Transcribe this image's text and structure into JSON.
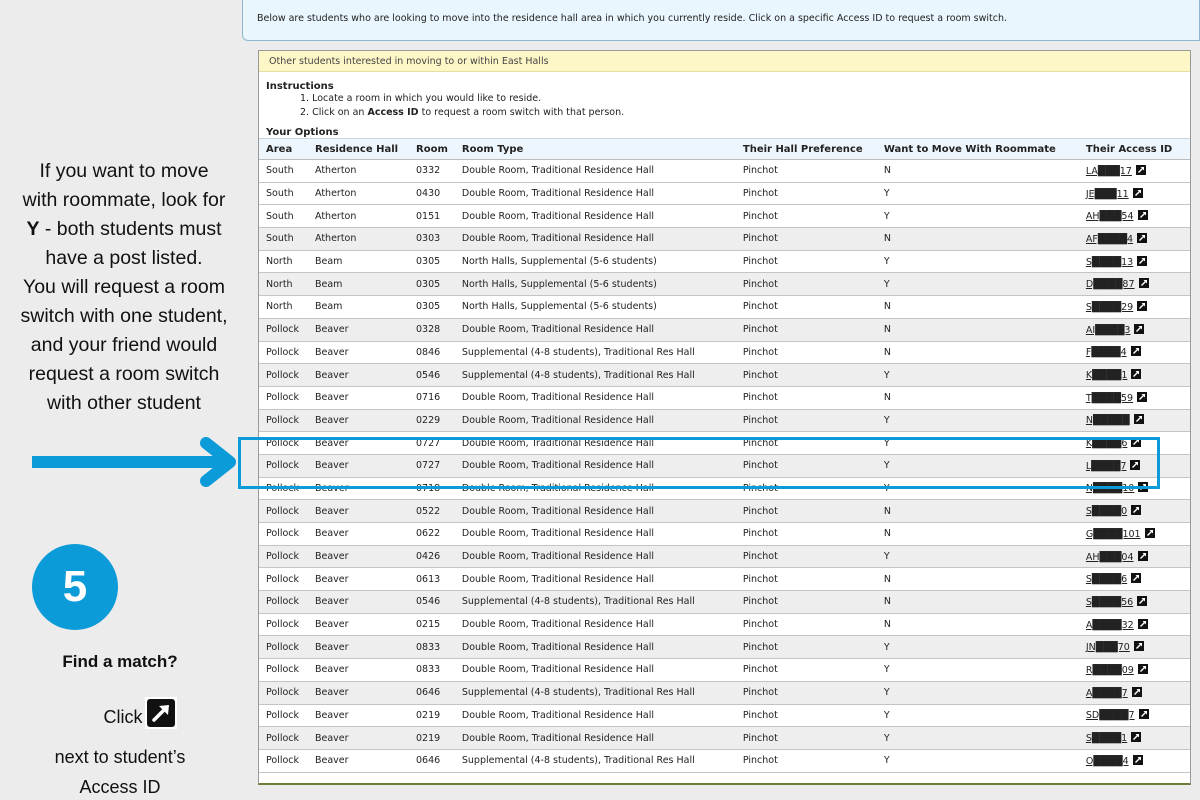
{
  "info_banner": "Below are students who are looking to move into the residence hall area in which you currently reside. Click on a specific Access ID to request a room switch.",
  "panel": {
    "header": "Other students interested in moving to or within East Halls",
    "instructions_title": "Instructions",
    "instructions": [
      {
        "prefix": "1. Locate a room in which you would like to reside.",
        "bold": "",
        "suffix": ""
      },
      {
        "prefix": "2. Click on an ",
        "bold": "Access ID",
        "suffix": " to request a room switch with that person."
      }
    ],
    "options_title": "Your Options"
  },
  "table": {
    "columns": [
      "Area",
      "Residence Hall",
      "Room",
      "Room Type",
      "Their Hall Preference",
      "Want to Move With Roommate",
      "Their Access ID"
    ],
    "rows": [
      {
        "area": "South",
        "hall": "Atherton",
        "room": "0332",
        "type": "Double Room, Traditional Residence Hall",
        "pref": "Pinchot",
        "want": "N",
        "access_id": "LA███17"
      },
      {
        "area": "South",
        "hall": "Atherton",
        "room": "0430",
        "type": "Double Room, Traditional Residence Hall",
        "pref": "Pinchot",
        "want": "Y",
        "access_id": "JE███11"
      },
      {
        "area": "South",
        "hall": "Atherton",
        "room": "0151",
        "type": "Double Room, Traditional Residence Hall",
        "pref": "Pinchot",
        "want": "Y",
        "access_id": "AH███54"
      },
      {
        "area": "South",
        "hall": "Atherton",
        "room": "0303",
        "type": "Double Room, Traditional Residence Hall",
        "pref": "Pinchot",
        "want": "N",
        "access_id": "AF████4"
      },
      {
        "area": "North",
        "hall": "Beam",
        "room": "0305",
        "type": "North Halls, Supplemental (5-6 students)",
        "pref": "Pinchot",
        "want": "Y",
        "access_id": "S████13"
      },
      {
        "area": "North",
        "hall": "Beam",
        "room": "0305",
        "type": "North Halls, Supplemental (5-6 students)",
        "pref": "Pinchot",
        "want": "Y",
        "access_id": "D████87"
      },
      {
        "area": "North",
        "hall": "Beam",
        "room": "0305",
        "type": "North Halls, Supplemental (5-6 students)",
        "pref": "Pinchot",
        "want": "N",
        "access_id": "S████29"
      },
      {
        "area": "Pollock",
        "hall": "Beaver",
        "room": "0328",
        "type": "Double Room, Traditional Residence Hall",
        "pref": "Pinchot",
        "want": "N",
        "access_id": "AI████3"
      },
      {
        "area": "Pollock",
        "hall": "Beaver",
        "room": "0846",
        "type": "Supplemental (4-8 students), Traditional Res Hall",
        "pref": "Pinchot",
        "want": "N",
        "access_id": "F████4"
      },
      {
        "area": "Pollock",
        "hall": "Beaver",
        "room": "0546",
        "type": "Supplemental (4-8 students), Traditional Res Hall",
        "pref": "Pinchot",
        "want": "Y",
        "access_id": "K████1"
      },
      {
        "area": "Pollock",
        "hall": "Beaver",
        "room": "0716",
        "type": "Double Room, Traditional Residence Hall",
        "pref": "Pinchot",
        "want": "N",
        "access_id": "T████59"
      },
      {
        "area": "Pollock",
        "hall": "Beaver",
        "room": "0229",
        "type": "Double Room, Traditional Residence Hall",
        "pref": "Pinchot",
        "want": "Y",
        "access_id": "N█████"
      },
      {
        "area": "Pollock",
        "hall": "Beaver",
        "room": "0727",
        "type": "Double Room, Traditional Residence Hall",
        "pref": "Pinchot",
        "want": "Y",
        "access_id": "K████6"
      },
      {
        "area": "Pollock",
        "hall": "Beaver",
        "room": "0727",
        "type": "Double Room, Traditional Residence Hall",
        "pref": "Pinchot",
        "want": "Y",
        "access_id": "L████7"
      },
      {
        "area": "Pollock",
        "hall": "Beaver",
        "room": "0718",
        "type": "Double Room, Traditional Residence Hall",
        "pref": "Pinchot",
        "want": "Y",
        "access_id": "N████10"
      },
      {
        "area": "Pollock",
        "hall": "Beaver",
        "room": "0522",
        "type": "Double Room, Traditional Residence Hall",
        "pref": "Pinchot",
        "want": "N",
        "access_id": "S████0"
      },
      {
        "area": "Pollock",
        "hall": "Beaver",
        "room": "0622",
        "type": "Double Room, Traditional Residence Hall",
        "pref": "Pinchot",
        "want": "N",
        "access_id": "G████101"
      },
      {
        "area": "Pollock",
        "hall": "Beaver",
        "room": "0426",
        "type": "Double Room, Traditional Residence Hall",
        "pref": "Pinchot",
        "want": "Y",
        "access_id": "AH███04"
      },
      {
        "area": "Pollock",
        "hall": "Beaver",
        "room": "0613",
        "type": "Double Room, Traditional Residence Hall",
        "pref": "Pinchot",
        "want": "N",
        "access_id": "S████6"
      },
      {
        "area": "Pollock",
        "hall": "Beaver",
        "room": "0546",
        "type": "Supplemental (4-8 students), Traditional Res Hall",
        "pref": "Pinchot",
        "want": "N",
        "access_id": "S████56"
      },
      {
        "area": "Pollock",
        "hall": "Beaver",
        "room": "0215",
        "type": "Double Room, Traditional Residence Hall",
        "pref": "Pinchot",
        "want": "N",
        "access_id": "A████32"
      },
      {
        "area": "Pollock",
        "hall": "Beaver",
        "room": "0833",
        "type": "Double Room, Traditional Residence Hall",
        "pref": "Pinchot",
        "want": "Y",
        "access_id": "JN███70"
      },
      {
        "area": "Pollock",
        "hall": "Beaver",
        "room": "0833",
        "type": "Double Room, Traditional Residence Hall",
        "pref": "Pinchot",
        "want": "Y",
        "access_id": "R████09"
      },
      {
        "area": "Pollock",
        "hall": "Beaver",
        "room": "0646",
        "type": "Supplemental (4-8 students), Traditional Res Hall",
        "pref": "Pinchot",
        "want": "Y",
        "access_id": "A████7"
      },
      {
        "area": "Pollock",
        "hall": "Beaver",
        "room": "0219",
        "type": "Double Room, Traditional Residence Hall",
        "pref": "Pinchot",
        "want": "Y",
        "access_id": "SD████7"
      },
      {
        "area": "Pollock",
        "hall": "Beaver",
        "room": "0219",
        "type": "Double Room, Traditional Residence Hall",
        "pref": "Pinchot",
        "want": "Y",
        "access_id": "S████1"
      },
      {
        "area": "Pollock",
        "hall": "Beaver",
        "room": "0646",
        "type": "Supplemental (4-8 students), Traditional Res Hall",
        "pref": "Pinchot",
        "want": "Y",
        "access_id": "O████4"
      }
    ]
  },
  "annotation": {
    "tip_lines": [
      "If you want to move",
      "with roommate, look for",
      "- both students must",
      "have a post listed.",
      "You will request a room",
      "switch with one student,",
      "and your friend would",
      "request a room switch",
      "with other student"
    ],
    "tip_bold_letter": "Y",
    "step_number": "5",
    "find_match": "Find a match?",
    "click_label": "Click",
    "next_to_line1": "next to student’s",
    "next_to_line2": "Access ID",
    "accent_color": "#0b9bd9"
  }
}
